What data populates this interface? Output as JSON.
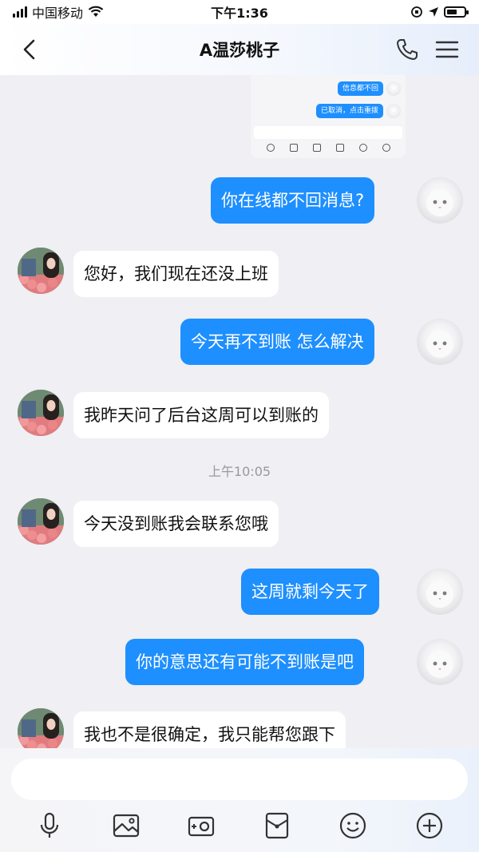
{
  "status_bar": {
    "carrier": "中国移动",
    "time": "下午1:36"
  },
  "header": {
    "title": "A温莎桃子"
  },
  "quoted_screenshot": {
    "messages": [
      "信息都不回",
      "已取消，点击重拨"
    ]
  },
  "messages": [
    {
      "side": "out",
      "text": "你在线都不回消息?"
    },
    {
      "side": "in",
      "text": "您好，我们现在还没上班"
    },
    {
      "side": "out",
      "text": "今天再不到账 怎么解决"
    },
    {
      "side": "in",
      "text": "我昨天问了后台这周可以到账的"
    },
    {
      "side": "time",
      "text": "上午10:05"
    },
    {
      "side": "in",
      "text": "今天没到账我会联系您哦"
    },
    {
      "side": "out",
      "text": "这周就剩今天了"
    },
    {
      "side": "out",
      "text": "你的意思还有可能不到账是吧"
    },
    {
      "side": "in",
      "text": "我也不是很确定，我只能帮您跟下"
    }
  ],
  "composer": {
    "placeholder": "",
    "toolbar": [
      "microphone-icon",
      "image-icon",
      "camera-icon",
      "red-packet-icon",
      "emoji-icon",
      "plus-icon"
    ]
  },
  "colors": {
    "bubble_out": "#1e8ffe",
    "bubble_in": "#ffffff",
    "background": "#efeff4"
  }
}
